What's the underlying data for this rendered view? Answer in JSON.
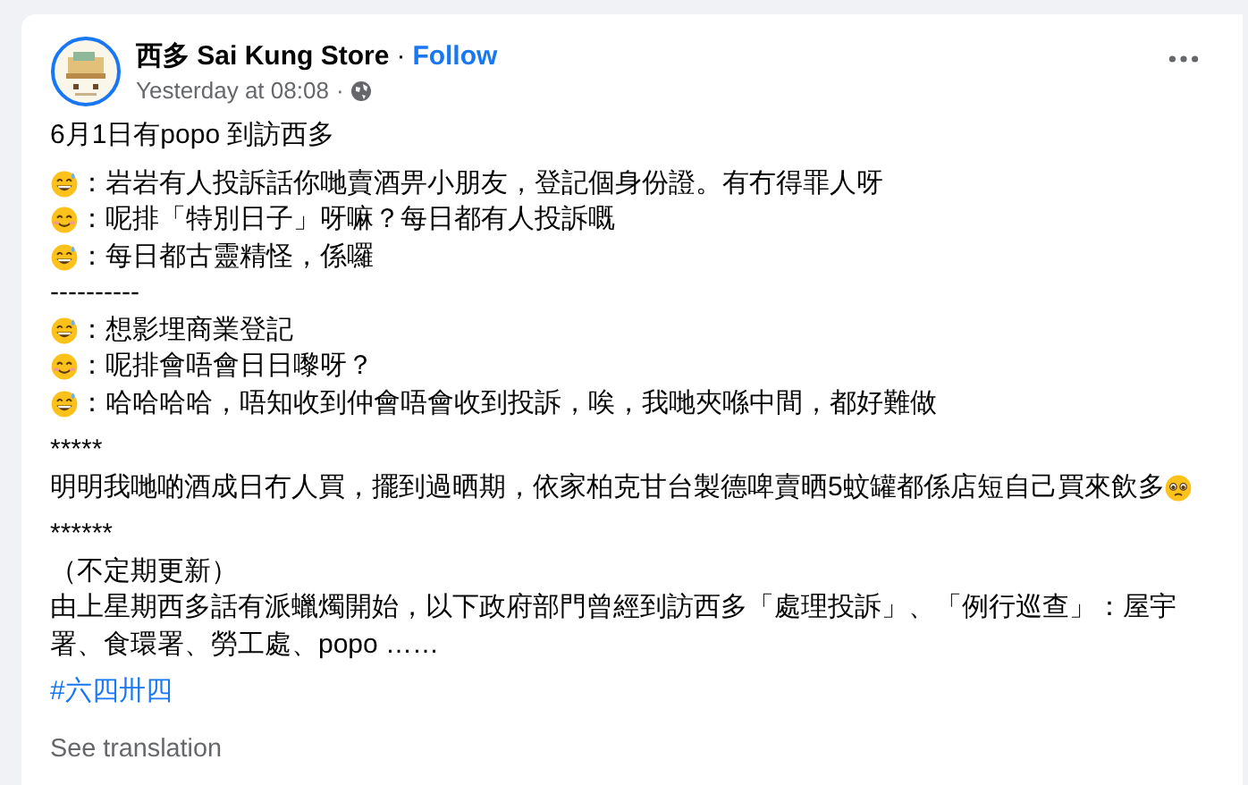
{
  "post": {
    "author": "西多 Sai Kung Store",
    "separator": "·",
    "follow": "Follow",
    "time": "Yesterday at 08:08",
    "time_separator": "·",
    "paragraphs": [
      {
        "lines": [
          {
            "kind": "plain",
            "text": "6月1日有popo 到訪西多"
          }
        ]
      },
      {
        "lines": [
          {
            "kind": "sweat",
            "text": "：岩岩有人投訴話你哋賣酒畀小朋友，登記個身份證。有冇得罪人呀"
          },
          {
            "kind": "smile",
            "text": "：呢排「特別日子」呀嘛？每日都有人投訴嘅"
          },
          {
            "kind": "sweat",
            "text": "：每日都古靈精怪，係囉"
          },
          {
            "kind": "plain",
            "text": "----------"
          },
          {
            "kind": "sweat",
            "text": "：想影埋商業登記"
          },
          {
            "kind": "smile",
            "text": "：呢排會唔會日日嚟呀？"
          },
          {
            "kind": "sweat",
            "text": "：哈哈哈哈，唔知收到仲會唔會收到投訴，唉，我哋夾喺中間，都好難做"
          }
        ]
      },
      {
        "lines": [
          {
            "kind": "plain",
            "text": "*****"
          },
          {
            "kind": "teary",
            "text": "明明我哋啲酒成日冇人買，擺到過晒期，依家柏克甘台製德啤賣晒5蚊罐都係店短自己買來飲多"
          }
        ]
      },
      {
        "lines": [
          {
            "kind": "plain",
            "text": "******"
          },
          {
            "kind": "plain",
            "text": "（不定期更新）"
          },
          {
            "kind": "plain",
            "text": "由上星期西多話有派蠟燭開始，以下政府部門曾經到訪西多「處理投訴」、「例行巡查」：屋宇署、食環署、勞工處、popo ……"
          }
        ]
      }
    ],
    "hashtag": "#六四卅四",
    "see_translation": "See translation"
  }
}
